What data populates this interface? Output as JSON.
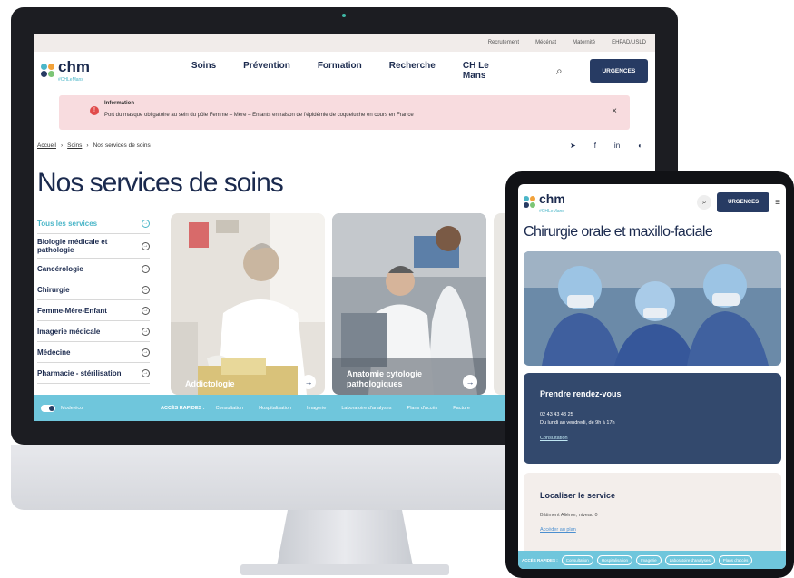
{
  "desktop": {
    "topbar": [
      "Recrutement",
      "Mécénat",
      "Maternité",
      "EHPAD/USLD"
    ],
    "logo": {
      "name": "chm",
      "tagline": "#CHLeMans"
    },
    "nav": [
      "Soins",
      "Prévention",
      "Formation",
      "Recherche",
      "CH Le Mans"
    ],
    "search_icon": "search-icon",
    "urgences": "URGENCES",
    "alert": {
      "title": "Information",
      "text": "Port du masque obligatoire au sein du pôle Femme – Mère – Enfants en raison de l'épidémie de coqueluche en cours en France",
      "close": "×"
    },
    "breadcrumb": {
      "home": "Accueil",
      "soins": "Soins",
      "current": "Nos services de soins"
    },
    "share_icons": [
      "send-icon",
      "facebook-icon",
      "linkedin-icon",
      "share-icon"
    ],
    "title": "Nos services de soins",
    "services": [
      "Tous les services",
      "Biologie médicale et pathologie",
      "Cancérologie",
      "Chirurgie",
      "Femme-Mère-Enfant",
      "Imagerie médicale",
      "Médecine",
      "Pharmacie - stérilisation"
    ],
    "cards": [
      {
        "title": "Addictologie"
      },
      {
        "title": "Anatomie cytologie pathologiques"
      }
    ],
    "quick": {
      "mode": "Mode éco",
      "label": "ACCÈS RAPIDES :",
      "links": [
        "Consultation",
        "Hospitalisation",
        "Imagerie",
        "Laboratoire d'analyses",
        "Plans d'accès",
        "Facture"
      ]
    }
  },
  "tablet": {
    "urgences": "URGENCES",
    "title": "Chirurgie orale et maxillo-faciale",
    "rdv": {
      "title": "Prendre rendez-vous",
      "phone": "02 43 43 43 25",
      "hours": "Du lundi au vendredi, de 9h à 17h",
      "link": "Consultation"
    },
    "loc": {
      "title": "Localiser le service",
      "address": "Bâtiment Aliénor, niveau 0",
      "link": "Accéder au plan"
    },
    "quick": {
      "label": "ACCÈS RAPIDES :",
      "links": [
        "Consultation",
        "Hospitalisation",
        "Imagerie",
        "Laboratoire d'analyses",
        "Plans d'accès"
      ]
    }
  },
  "colors": {
    "navy": "#273b63",
    "teal": "#4bb6c8",
    "quickbar": "#6fc6dc",
    "alert": "#f8dcdf"
  }
}
